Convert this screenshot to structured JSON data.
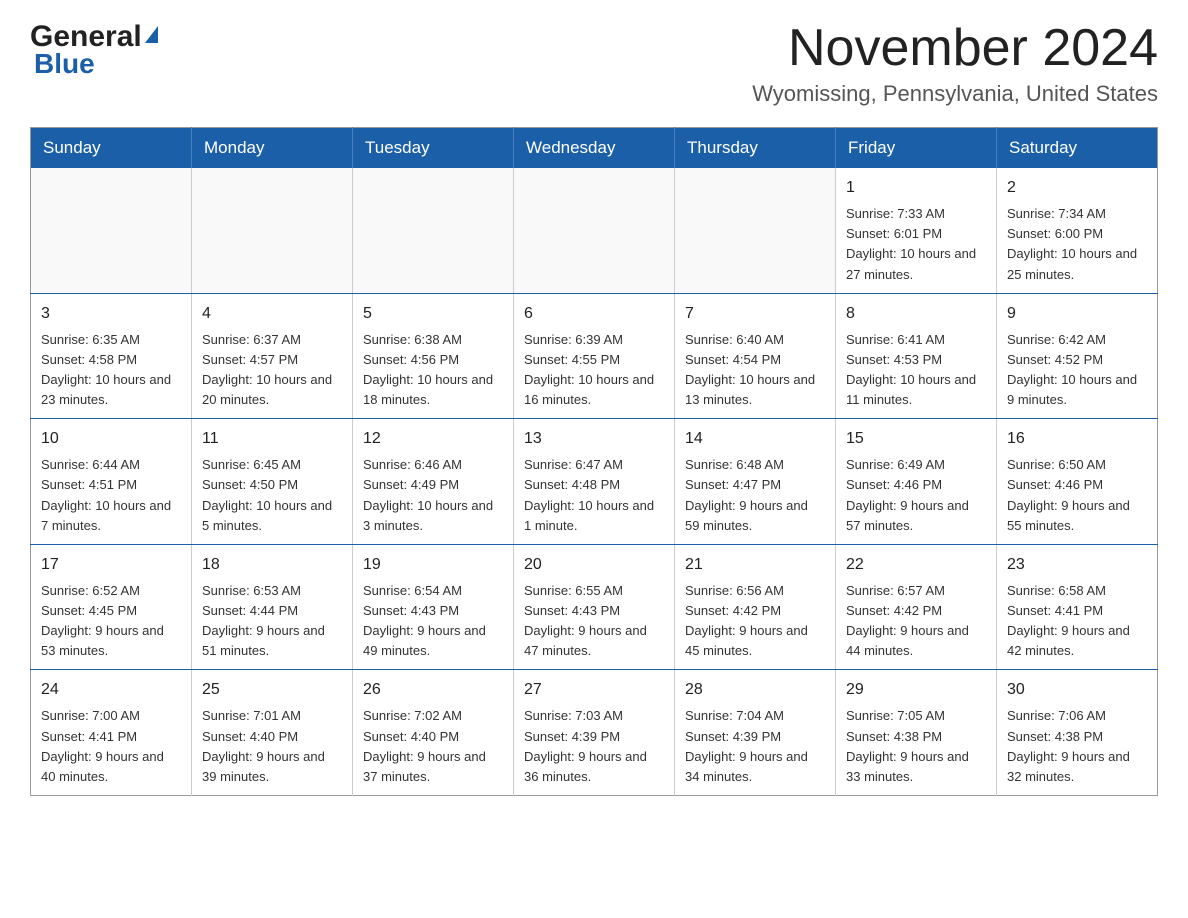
{
  "header": {
    "logo_general": "General",
    "logo_blue": "Blue",
    "month_title": "November 2024",
    "location": "Wyomissing, Pennsylvania, United States"
  },
  "calendar": {
    "days_of_week": [
      "Sunday",
      "Monday",
      "Tuesday",
      "Wednesday",
      "Thursday",
      "Friday",
      "Saturday"
    ],
    "weeks": [
      [
        {
          "day": "",
          "info": ""
        },
        {
          "day": "",
          "info": ""
        },
        {
          "day": "",
          "info": ""
        },
        {
          "day": "",
          "info": ""
        },
        {
          "day": "",
          "info": ""
        },
        {
          "day": "1",
          "info": "Sunrise: 7:33 AM\nSunset: 6:01 PM\nDaylight: 10 hours and 27 minutes."
        },
        {
          "day": "2",
          "info": "Sunrise: 7:34 AM\nSunset: 6:00 PM\nDaylight: 10 hours and 25 minutes."
        }
      ],
      [
        {
          "day": "3",
          "info": "Sunrise: 6:35 AM\nSunset: 4:58 PM\nDaylight: 10 hours and 23 minutes."
        },
        {
          "day": "4",
          "info": "Sunrise: 6:37 AM\nSunset: 4:57 PM\nDaylight: 10 hours and 20 minutes."
        },
        {
          "day": "5",
          "info": "Sunrise: 6:38 AM\nSunset: 4:56 PM\nDaylight: 10 hours and 18 minutes."
        },
        {
          "day": "6",
          "info": "Sunrise: 6:39 AM\nSunset: 4:55 PM\nDaylight: 10 hours and 16 minutes."
        },
        {
          "day": "7",
          "info": "Sunrise: 6:40 AM\nSunset: 4:54 PM\nDaylight: 10 hours and 13 minutes."
        },
        {
          "day": "8",
          "info": "Sunrise: 6:41 AM\nSunset: 4:53 PM\nDaylight: 10 hours and 11 minutes."
        },
        {
          "day": "9",
          "info": "Sunrise: 6:42 AM\nSunset: 4:52 PM\nDaylight: 10 hours and 9 minutes."
        }
      ],
      [
        {
          "day": "10",
          "info": "Sunrise: 6:44 AM\nSunset: 4:51 PM\nDaylight: 10 hours and 7 minutes."
        },
        {
          "day": "11",
          "info": "Sunrise: 6:45 AM\nSunset: 4:50 PM\nDaylight: 10 hours and 5 minutes."
        },
        {
          "day": "12",
          "info": "Sunrise: 6:46 AM\nSunset: 4:49 PM\nDaylight: 10 hours and 3 minutes."
        },
        {
          "day": "13",
          "info": "Sunrise: 6:47 AM\nSunset: 4:48 PM\nDaylight: 10 hours and 1 minute."
        },
        {
          "day": "14",
          "info": "Sunrise: 6:48 AM\nSunset: 4:47 PM\nDaylight: 9 hours and 59 minutes."
        },
        {
          "day": "15",
          "info": "Sunrise: 6:49 AM\nSunset: 4:46 PM\nDaylight: 9 hours and 57 minutes."
        },
        {
          "day": "16",
          "info": "Sunrise: 6:50 AM\nSunset: 4:46 PM\nDaylight: 9 hours and 55 minutes."
        }
      ],
      [
        {
          "day": "17",
          "info": "Sunrise: 6:52 AM\nSunset: 4:45 PM\nDaylight: 9 hours and 53 minutes."
        },
        {
          "day": "18",
          "info": "Sunrise: 6:53 AM\nSunset: 4:44 PM\nDaylight: 9 hours and 51 minutes."
        },
        {
          "day": "19",
          "info": "Sunrise: 6:54 AM\nSunset: 4:43 PM\nDaylight: 9 hours and 49 minutes."
        },
        {
          "day": "20",
          "info": "Sunrise: 6:55 AM\nSunset: 4:43 PM\nDaylight: 9 hours and 47 minutes."
        },
        {
          "day": "21",
          "info": "Sunrise: 6:56 AM\nSunset: 4:42 PM\nDaylight: 9 hours and 45 minutes."
        },
        {
          "day": "22",
          "info": "Sunrise: 6:57 AM\nSunset: 4:42 PM\nDaylight: 9 hours and 44 minutes."
        },
        {
          "day": "23",
          "info": "Sunrise: 6:58 AM\nSunset: 4:41 PM\nDaylight: 9 hours and 42 minutes."
        }
      ],
      [
        {
          "day": "24",
          "info": "Sunrise: 7:00 AM\nSunset: 4:41 PM\nDaylight: 9 hours and 40 minutes."
        },
        {
          "day": "25",
          "info": "Sunrise: 7:01 AM\nSunset: 4:40 PM\nDaylight: 9 hours and 39 minutes."
        },
        {
          "day": "26",
          "info": "Sunrise: 7:02 AM\nSunset: 4:40 PM\nDaylight: 9 hours and 37 minutes."
        },
        {
          "day": "27",
          "info": "Sunrise: 7:03 AM\nSunset: 4:39 PM\nDaylight: 9 hours and 36 minutes."
        },
        {
          "day": "28",
          "info": "Sunrise: 7:04 AM\nSunset: 4:39 PM\nDaylight: 9 hours and 34 minutes."
        },
        {
          "day": "29",
          "info": "Sunrise: 7:05 AM\nSunset: 4:38 PM\nDaylight: 9 hours and 33 minutes."
        },
        {
          "day": "30",
          "info": "Sunrise: 7:06 AM\nSunset: 4:38 PM\nDaylight: 9 hours and 32 minutes."
        }
      ]
    ]
  }
}
